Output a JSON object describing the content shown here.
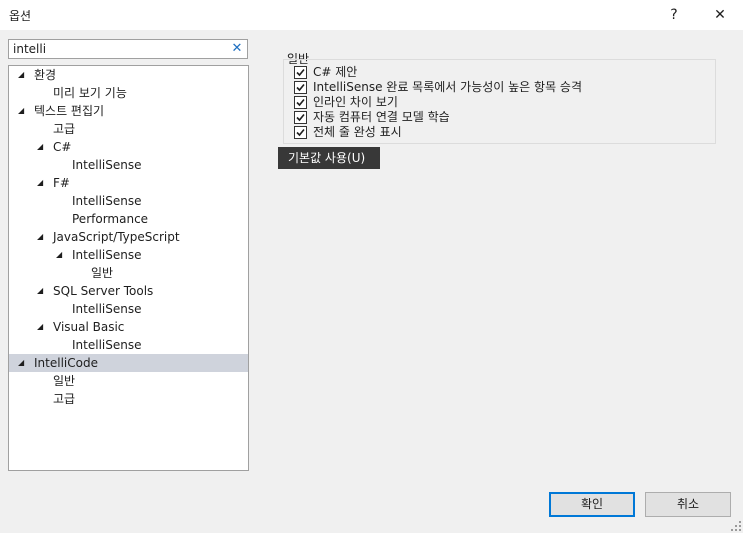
{
  "window": {
    "title": "옵션",
    "help_label": "?",
    "close_label": "✕"
  },
  "search": {
    "value": "intelli",
    "clear_label": "✕"
  },
  "tree": [
    {
      "label": "환경",
      "expanded": true,
      "arrow": "◢"
    },
    {
      "label": "미리 보기 기능"
    },
    {
      "label": "텍스트 편집기",
      "expanded": true,
      "arrow": "◢"
    },
    {
      "label": "고급"
    },
    {
      "label": "C#",
      "expanded": true,
      "arrow": "◢"
    },
    {
      "label": "IntelliSense"
    },
    {
      "label": "F#",
      "expanded": true,
      "arrow": "◢"
    },
    {
      "label": "IntelliSense"
    },
    {
      "label": "Performance"
    },
    {
      "label": "JavaScript/TypeScript",
      "expanded": true,
      "arrow": "◢"
    },
    {
      "label": "IntelliSense",
      "expanded": true,
      "arrow": "◢"
    },
    {
      "label": "일반"
    },
    {
      "label": "SQL Server Tools",
      "expanded": true,
      "arrow": "◢"
    },
    {
      "label": "IntelliSense"
    },
    {
      "label": "Visual Basic",
      "expanded": true,
      "arrow": "◢"
    },
    {
      "label": "IntelliSense"
    },
    {
      "label": "IntelliCode",
      "expanded": true,
      "arrow": "◢",
      "selected": true
    },
    {
      "label": "일반"
    },
    {
      "label": "고급"
    }
  ],
  "content": {
    "section_label": "일반",
    "options": [
      {
        "label": "C# 제안",
        "checked": true
      },
      {
        "label": "IntelliSense 완료 목록에서 가능성이 높은 항목 승격",
        "checked": true
      },
      {
        "label": "인라인 차이 보기",
        "checked": true
      },
      {
        "label": "자동 컴퓨터 연결 모델 학습",
        "checked": true
      },
      {
        "label": "전체 줄 완성 표시",
        "checked": true
      }
    ],
    "reset_label": "기본값 사용(U)"
  },
  "footer": {
    "ok_label": "확인",
    "cancel_label": "취소"
  },
  "colors": {
    "selection": "#cfd3dc",
    "accent": "#0078d7",
    "search_clear": "#1e6fc1"
  }
}
